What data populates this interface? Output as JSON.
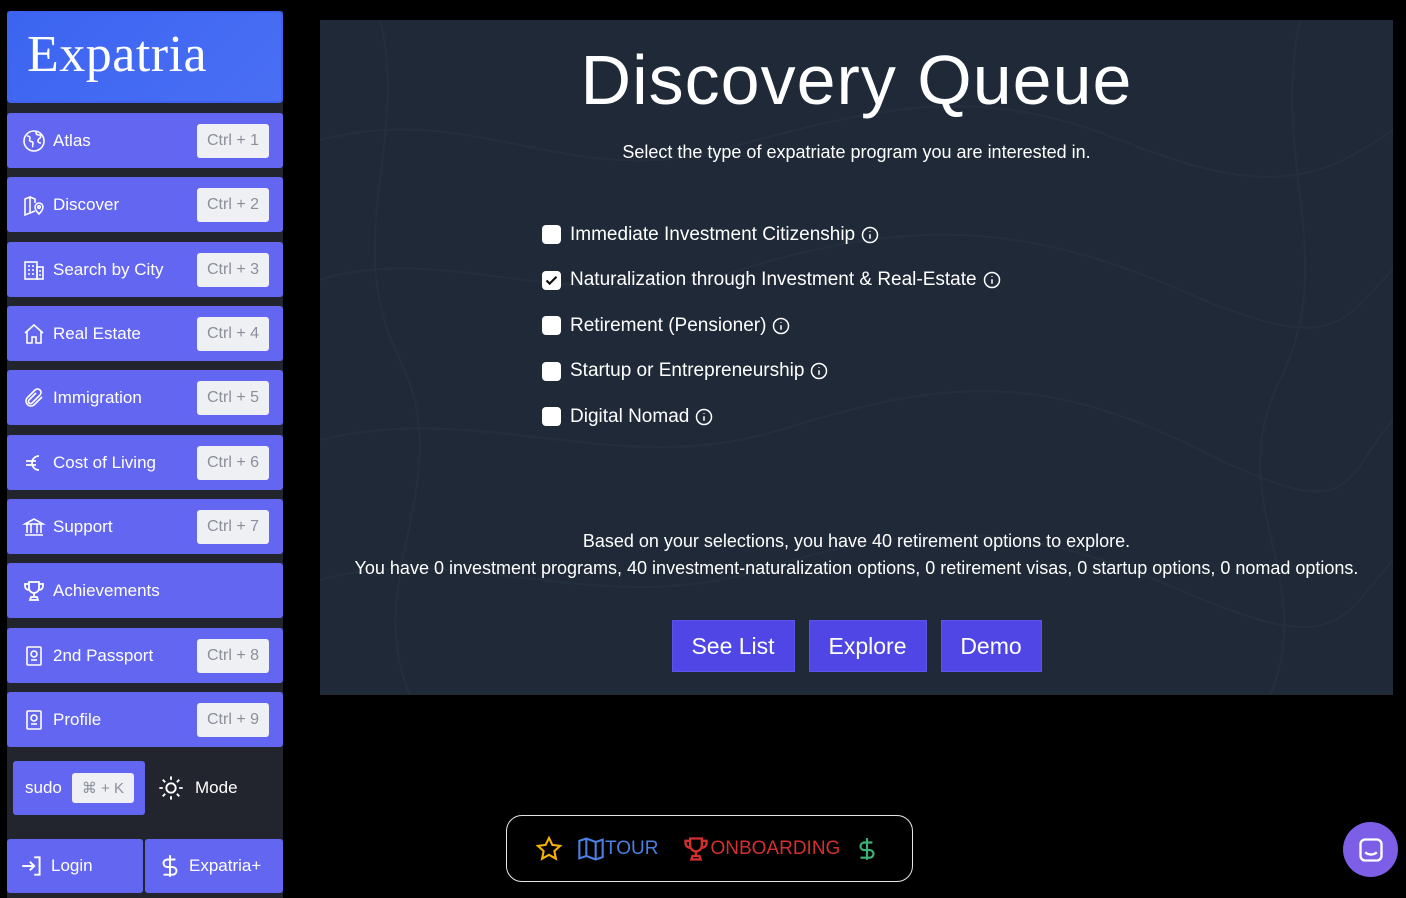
{
  "sidebar": {
    "logo": "Expatria",
    "items": [
      {
        "label": "Atlas",
        "shortcut": "Ctrl + 1",
        "icon": "globe-icon"
      },
      {
        "label": "Discover",
        "shortcut": "Ctrl + 2",
        "icon": "map-pin-icon"
      },
      {
        "label": "Search by City",
        "shortcut": "Ctrl + 3",
        "icon": "building-icon"
      },
      {
        "label": "Real Estate",
        "shortcut": "Ctrl + 4",
        "icon": "home-icon"
      },
      {
        "label": "Immigration",
        "shortcut": "Ctrl + 5",
        "icon": "paperclip-icon"
      },
      {
        "label": "Cost of Living",
        "shortcut": "Ctrl + 6",
        "icon": "euro-icon"
      },
      {
        "label": "Support",
        "shortcut": "Ctrl + 7",
        "icon": "bank-icon"
      },
      {
        "label": "Achievements",
        "shortcut": "",
        "icon": "trophy-icon"
      },
      {
        "label": "2nd Passport",
        "shortcut": "Ctrl + 8",
        "icon": "passport-icon"
      },
      {
        "label": "Profile",
        "shortcut": "Ctrl + 9",
        "icon": "passport-icon"
      }
    ],
    "sudo_label": "sudo",
    "sudo_shortcut": "⌘ + K",
    "mode_label": "Mode",
    "login_label": "Login",
    "plus_label": "Expatria+"
  },
  "main": {
    "title": "Discovery Queue",
    "subtitle": "Select the type of expatriate program you are interested in.",
    "options": [
      {
        "label": "Immediate Investment Citizenship",
        "checked": false
      },
      {
        "label": "Naturalization through Investment & Real-Estate",
        "checked": true
      },
      {
        "label": "Retirement (Pensioner)",
        "checked": false
      },
      {
        "label": "Startup or Entrepreneurship",
        "checked": false
      },
      {
        "label": "Digital Nomad",
        "checked": false
      }
    ],
    "summary_line1": "Based on your selections, you have 40 retirement options to explore.",
    "summary_line2": "You have 0 investment programs, 40 investment-naturalization options, 0 retirement visas, 0 startup options, 0 nomad options.",
    "buttons": [
      "See List",
      "Explore",
      "Demo"
    ]
  },
  "bottom_bar": {
    "tour_label": "TOUR",
    "onboarding_label": "ONBOARDING"
  },
  "colors": {
    "nav_bg": "#6366f1",
    "logo_bg": "#3b64f0",
    "panel_bg": "#1f2937",
    "cta_bg": "#4f46e5",
    "tour": "#4d7fe0",
    "onboarding": "#d32f2f",
    "star": "#f5b300",
    "dollar": "#3bb273",
    "chat": "#7c5fe6"
  }
}
